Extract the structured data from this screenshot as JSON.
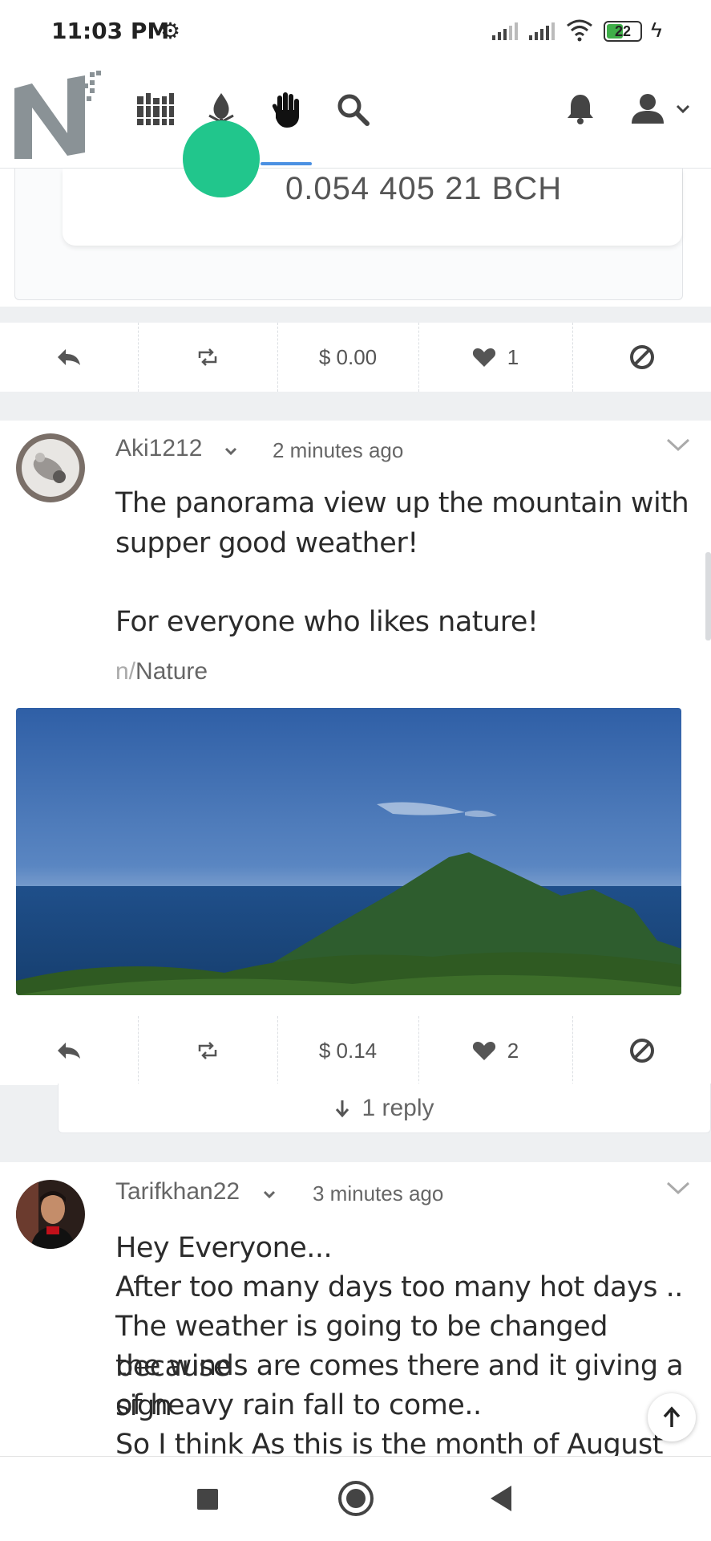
{
  "status_bar": {
    "time": "11:03 PM",
    "battery": "22"
  },
  "header": {
    "nav_icons": [
      "library-icon",
      "flame-icon",
      "hand-icon",
      "search-icon"
    ],
    "right_icons": [
      "bell-icon",
      "user-icon"
    ]
  },
  "wallet_card": {
    "amount": "0.054 405 21 BCH"
  },
  "post0_actions": {
    "tip": "$ 0.00",
    "likes": "1"
  },
  "post1": {
    "username": "Aki1212",
    "time": "2 minutes ago",
    "line1": "The panorama view up the mountain with",
    "line2": "supper good weather!",
    "line3": "For everyone who likes nature!",
    "tag_prefix": "n/",
    "tag": "Nature",
    "tip": "$ 0.14",
    "likes": "2",
    "replies": "1 reply"
  },
  "post2": {
    "username": "Tarifkhan22",
    "time": "3 minutes ago",
    "lines": [
      "Hey Everyone...",
      "After too many days too many hot days ..",
      "The weather is going to be changed because",
      "the winds are comes there and it giving a sign",
      "of heavy rain fall to come..",
      "So I think As this is the month of August and"
    ]
  }
}
